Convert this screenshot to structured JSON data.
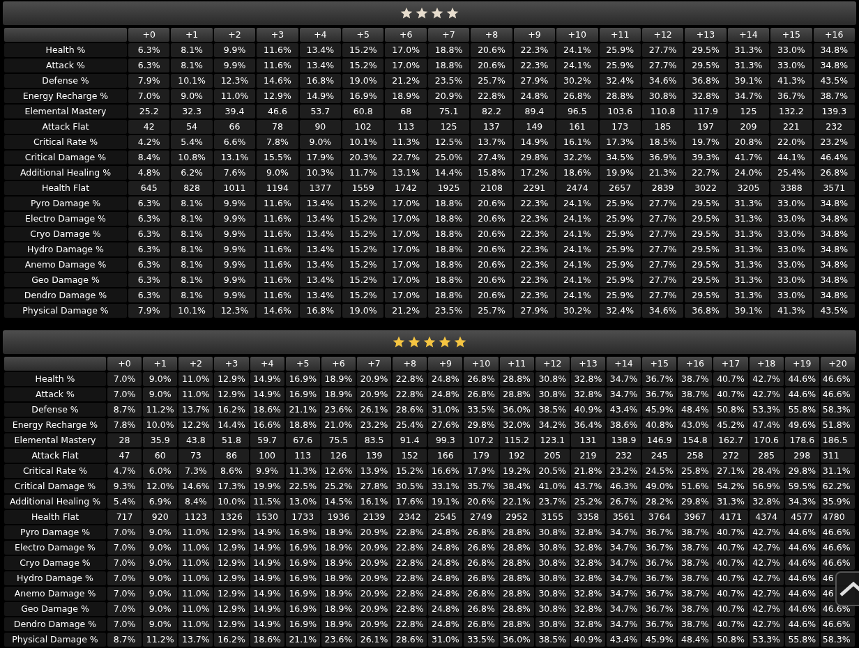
{
  "panels": [
    {
      "stars": 4,
      "color": "#e6dccd",
      "columns": [
        "+0",
        "+1",
        "+2",
        "+3",
        "+4",
        "+5",
        "+6",
        "+7",
        "+8",
        "+9",
        "+10",
        "+11",
        "+12",
        "+13",
        "+14",
        "+15",
        "+16"
      ],
      "rows": [
        {
          "label": "Health %",
          "cells": [
            "6.3%",
            "8.1%",
            "9.9%",
            "11.6%",
            "13.4%",
            "15.2%",
            "17.0%",
            "18.8%",
            "20.6%",
            "22.3%",
            "24.1%",
            "25.9%",
            "27.7%",
            "29.5%",
            "31.3%",
            "33.0%",
            "34.8%"
          ]
        },
        {
          "label": "Attack %",
          "cells": [
            "6.3%",
            "8.1%",
            "9.9%",
            "11.6%",
            "13.4%",
            "15.2%",
            "17.0%",
            "18.8%",
            "20.6%",
            "22.3%",
            "24.1%",
            "25.9%",
            "27.7%",
            "29.5%",
            "31.3%",
            "33.0%",
            "34.8%"
          ]
        },
        {
          "label": "Defense %",
          "cells": [
            "7.9%",
            "10.1%",
            "12.3%",
            "14.6%",
            "16.8%",
            "19.0%",
            "21.2%",
            "23.5%",
            "25.7%",
            "27.9%",
            "30.2%",
            "32.4%",
            "34.6%",
            "36.8%",
            "39.1%",
            "41.3%",
            "43.5%"
          ]
        },
        {
          "label": "Energy Recharge %",
          "cells": [
            "7.0%",
            "9.0%",
            "11.0%",
            "12.9%",
            "14.9%",
            "16.9%",
            "18.9%",
            "20.9%",
            "22.8%",
            "24.8%",
            "26.8%",
            "28.8%",
            "30.8%",
            "32.8%",
            "34.7%",
            "36.7%",
            "38.7%"
          ]
        },
        {
          "label": "Elemental Mastery",
          "cells": [
            "25.2",
            "32.3",
            "39.4",
            "46.6",
            "53.7",
            "60.8",
            "68",
            "75.1",
            "82.2",
            "89.4",
            "96.5",
            "103.6",
            "110.8",
            "117.9",
            "125",
            "132.2",
            "139.3"
          ]
        },
        {
          "label": "Attack Flat",
          "cells": [
            "42",
            "54",
            "66",
            "78",
            "90",
            "102",
            "113",
            "125",
            "137",
            "149",
            "161",
            "173",
            "185",
            "197",
            "209",
            "221",
            "232"
          ]
        },
        {
          "label": "Critical Rate %",
          "cells": [
            "4.2%",
            "5.4%",
            "6.6%",
            "7.8%",
            "9.0%",
            "10.1%",
            "11.3%",
            "12.5%",
            "13.7%",
            "14.9%",
            "16.1%",
            "17.3%",
            "18.5%",
            "19.7%",
            "20.8%",
            "22.0%",
            "23.2%"
          ]
        },
        {
          "label": "Critical Damage %",
          "cells": [
            "8.4%",
            "10.8%",
            "13.1%",
            "15.5%",
            "17.9%",
            "20.3%",
            "22.7%",
            "25.0%",
            "27.4%",
            "29.8%",
            "32.2%",
            "34.5%",
            "36.9%",
            "39.3%",
            "41.7%",
            "44.1%",
            "46.4%"
          ]
        },
        {
          "label": "Additional Healing %",
          "cells": [
            "4.8%",
            "6.2%",
            "7.6%",
            "9.0%",
            "10.3%",
            "11.7%",
            "13.1%",
            "14.4%",
            "15.8%",
            "17.2%",
            "18.6%",
            "19.9%",
            "21.3%",
            "22.7%",
            "24.0%",
            "25.4%",
            "26.8%"
          ]
        },
        {
          "label": "Health Flat",
          "cells": [
            "645",
            "828",
            "1011",
            "1194",
            "1377",
            "1559",
            "1742",
            "1925",
            "2108",
            "2291",
            "2474",
            "2657",
            "2839",
            "3022",
            "3205",
            "3388",
            "3571"
          ]
        },
        {
          "label": "Pyro Damage %",
          "cells": [
            "6.3%",
            "8.1%",
            "9.9%",
            "11.6%",
            "13.4%",
            "15.2%",
            "17.0%",
            "18.8%",
            "20.6%",
            "22.3%",
            "24.1%",
            "25.9%",
            "27.7%",
            "29.5%",
            "31.3%",
            "33.0%",
            "34.8%"
          ]
        },
        {
          "label": "Electro Damage %",
          "cells": [
            "6.3%",
            "8.1%",
            "9.9%",
            "11.6%",
            "13.4%",
            "15.2%",
            "17.0%",
            "18.8%",
            "20.6%",
            "22.3%",
            "24.1%",
            "25.9%",
            "27.7%",
            "29.5%",
            "31.3%",
            "33.0%",
            "34.8%"
          ]
        },
        {
          "label": "Cryo Damage %",
          "cells": [
            "6.3%",
            "8.1%",
            "9.9%",
            "11.6%",
            "13.4%",
            "15.2%",
            "17.0%",
            "18.8%",
            "20.6%",
            "22.3%",
            "24.1%",
            "25.9%",
            "27.7%",
            "29.5%",
            "31.3%",
            "33.0%",
            "34.8%"
          ]
        },
        {
          "label": "Hydro Damage %",
          "cells": [
            "6.3%",
            "8.1%",
            "9.9%",
            "11.6%",
            "13.4%",
            "15.2%",
            "17.0%",
            "18.8%",
            "20.6%",
            "22.3%",
            "24.1%",
            "25.9%",
            "27.7%",
            "29.5%",
            "31.3%",
            "33.0%",
            "34.8%"
          ]
        },
        {
          "label": "Anemo Damage %",
          "cells": [
            "6.3%",
            "8.1%",
            "9.9%",
            "11.6%",
            "13.4%",
            "15.2%",
            "17.0%",
            "18.8%",
            "20.6%",
            "22.3%",
            "24.1%",
            "25.9%",
            "27.7%",
            "29.5%",
            "31.3%",
            "33.0%",
            "34.8%"
          ]
        },
        {
          "label": "Geo Damage %",
          "cells": [
            "6.3%",
            "8.1%",
            "9.9%",
            "11.6%",
            "13.4%",
            "15.2%",
            "17.0%",
            "18.8%",
            "20.6%",
            "22.3%",
            "24.1%",
            "25.9%",
            "27.7%",
            "29.5%",
            "31.3%",
            "33.0%",
            "34.8%"
          ]
        },
        {
          "label": "Dendro Damage %",
          "cells": [
            "6.3%",
            "8.1%",
            "9.9%",
            "11.6%",
            "13.4%",
            "15.2%",
            "17.0%",
            "18.8%",
            "20.6%",
            "22.3%",
            "24.1%",
            "25.9%",
            "27.7%",
            "29.5%",
            "31.3%",
            "33.0%",
            "34.8%"
          ]
        },
        {
          "label": "Physical Damage %",
          "cells": [
            "7.9%",
            "10.1%",
            "12.3%",
            "14.6%",
            "16.8%",
            "19.0%",
            "21.2%",
            "23.5%",
            "25.7%",
            "27.9%",
            "30.2%",
            "32.4%",
            "34.6%",
            "36.8%",
            "39.1%",
            "41.3%",
            "43.5%"
          ]
        }
      ]
    },
    {
      "stars": 5,
      "color": "#f5c542",
      "columns": [
        "+0",
        "+1",
        "+2",
        "+3",
        "+4",
        "+5",
        "+6",
        "+7",
        "+8",
        "+9",
        "+10",
        "+11",
        "+12",
        "+13",
        "+14",
        "+15",
        "+16",
        "+17",
        "+18",
        "+19",
        "+20"
      ],
      "rows": [
        {
          "label": "Health %",
          "cells": [
            "7.0%",
            "9.0%",
            "11.0%",
            "12.9%",
            "14.9%",
            "16.9%",
            "18.9%",
            "20.9%",
            "22.8%",
            "24.8%",
            "26.8%",
            "28.8%",
            "30.8%",
            "32.8%",
            "34.7%",
            "36.7%",
            "38.7%",
            "40.7%",
            "42.7%",
            "44.6%",
            "46.6%"
          ]
        },
        {
          "label": "Attack %",
          "cells": [
            "7.0%",
            "9.0%",
            "11.0%",
            "12.9%",
            "14.9%",
            "16.9%",
            "18.9%",
            "20.9%",
            "22.8%",
            "24.8%",
            "26.8%",
            "28.8%",
            "30.8%",
            "32.8%",
            "34.7%",
            "36.7%",
            "38.7%",
            "40.7%",
            "42.7%",
            "44.6%",
            "46.6%"
          ]
        },
        {
          "label": "Defense %",
          "cells": [
            "8.7%",
            "11.2%",
            "13.7%",
            "16.2%",
            "18.6%",
            "21.1%",
            "23.6%",
            "26.1%",
            "28.6%",
            "31.0%",
            "33.5%",
            "36.0%",
            "38.5%",
            "40.9%",
            "43.4%",
            "45.9%",
            "48.4%",
            "50.8%",
            "53.3%",
            "55.8%",
            "58.3%"
          ]
        },
        {
          "label": "Energy Recharge %",
          "cells": [
            "7.8%",
            "10.0%",
            "12.2%",
            "14.4%",
            "16.6%",
            "18.8%",
            "21.0%",
            "23.2%",
            "25.4%",
            "27.6%",
            "29.8%",
            "32.0%",
            "34.2%",
            "36.4%",
            "38.6%",
            "40.8%",
            "43.0%",
            "45.2%",
            "47.4%",
            "49.6%",
            "51.8%"
          ]
        },
        {
          "label": "Elemental Mastery",
          "cells": [
            "28",
            "35.9",
            "43.8",
            "51.8",
            "59.7",
            "67.6",
            "75.5",
            "83.5",
            "91.4",
            "99.3",
            "107.2",
            "115.2",
            "123.1",
            "131",
            "138.9",
            "146.9",
            "154.8",
            "162.7",
            "170.6",
            "178.6",
            "186.5"
          ]
        },
        {
          "label": "Attack Flat",
          "cells": [
            "47",
            "60",
            "73",
            "86",
            "100",
            "113",
            "126",
            "139",
            "152",
            "166",
            "179",
            "192",
            "205",
            "219",
            "232",
            "245",
            "258",
            "272",
            "285",
            "298",
            "311"
          ]
        },
        {
          "label": "Critical Rate %",
          "cells": [
            "4.7%",
            "6.0%",
            "7.3%",
            "8.6%",
            "9.9%",
            "11.3%",
            "12.6%",
            "13.9%",
            "15.2%",
            "16.6%",
            "17.9%",
            "19.2%",
            "20.5%",
            "21.8%",
            "23.2%",
            "24.5%",
            "25.8%",
            "27.1%",
            "28.4%",
            "29.8%",
            "31.1%"
          ]
        },
        {
          "label": "Critical Damage %",
          "cells": [
            "9.3%",
            "12.0%",
            "14.6%",
            "17.3%",
            "19.9%",
            "22.5%",
            "25.2%",
            "27.8%",
            "30.5%",
            "33.1%",
            "35.7%",
            "38.4%",
            "41.0%",
            "43.7%",
            "46.3%",
            "49.0%",
            "51.6%",
            "54.2%",
            "56.9%",
            "59.5%",
            "62.2%"
          ]
        },
        {
          "label": "Additional Healing %",
          "cells": [
            "5.4%",
            "6.9%",
            "8.4%",
            "10.0%",
            "11.5%",
            "13.0%",
            "14.5%",
            "16.1%",
            "17.6%",
            "19.1%",
            "20.6%",
            "22.1%",
            "23.7%",
            "25.2%",
            "26.7%",
            "28.2%",
            "29.8%",
            "31.3%",
            "32.8%",
            "34.3%",
            "35.9%"
          ]
        },
        {
          "label": "Health Flat",
          "cells": [
            "717",
            "920",
            "1123",
            "1326",
            "1530",
            "1733",
            "1936",
            "2139",
            "2342",
            "2545",
            "2749",
            "2952",
            "3155",
            "3358",
            "3561",
            "3764",
            "3967",
            "4171",
            "4374",
            "4577",
            "4780"
          ]
        },
        {
          "label": "Pyro Damage %",
          "cells": [
            "7.0%",
            "9.0%",
            "11.0%",
            "12.9%",
            "14.9%",
            "16.9%",
            "18.9%",
            "20.9%",
            "22.8%",
            "24.8%",
            "26.8%",
            "28.8%",
            "30.8%",
            "32.8%",
            "34.7%",
            "36.7%",
            "38.7%",
            "40.7%",
            "42.7%",
            "44.6%",
            "46.6%"
          ]
        },
        {
          "label": "Electro Damage %",
          "cells": [
            "7.0%",
            "9.0%",
            "11.0%",
            "12.9%",
            "14.9%",
            "16.9%",
            "18.9%",
            "20.9%",
            "22.8%",
            "24.8%",
            "26.8%",
            "28.8%",
            "30.8%",
            "32.8%",
            "34.7%",
            "36.7%",
            "38.7%",
            "40.7%",
            "42.7%",
            "44.6%",
            "46.6%"
          ]
        },
        {
          "label": "Cryo Damage %",
          "cells": [
            "7.0%",
            "9.0%",
            "11.0%",
            "12.9%",
            "14.9%",
            "16.9%",
            "18.9%",
            "20.9%",
            "22.8%",
            "24.8%",
            "26.8%",
            "28.8%",
            "30.8%",
            "32.8%",
            "34.7%",
            "36.7%",
            "38.7%",
            "40.7%",
            "42.7%",
            "44.6%",
            "46.6%"
          ]
        },
        {
          "label": "Hydro Damage %",
          "cells": [
            "7.0%",
            "9.0%",
            "11.0%",
            "12.9%",
            "14.9%",
            "16.9%",
            "18.9%",
            "20.9%",
            "22.8%",
            "24.8%",
            "26.8%",
            "28.8%",
            "30.8%",
            "32.8%",
            "34.7%",
            "36.7%",
            "38.7%",
            "40.7%",
            "42.7%",
            "44.6%",
            "46"
          ]
        },
        {
          "label": "Anemo Damage %",
          "cells": [
            "7.0%",
            "9.0%",
            "11.0%",
            "12.9%",
            "14.9%",
            "16.9%",
            "18.9%",
            "20.9%",
            "22.8%",
            "24.8%",
            "26.8%",
            "28.8%",
            "30.8%",
            "32.8%",
            "34.7%",
            "36.7%",
            "38.7%",
            "40.7%",
            "42.7%",
            "44.6%",
            "46"
          ]
        },
        {
          "label": "Geo Damage %",
          "cells": [
            "7.0%",
            "9.0%",
            "11.0%",
            "12.9%",
            "14.9%",
            "16.9%",
            "18.9%",
            "20.9%",
            "22.8%",
            "24.8%",
            "26.8%",
            "28.8%",
            "30.8%",
            "32.8%",
            "34.7%",
            "36.7%",
            "38.7%",
            "40.7%",
            "42.7%",
            "44.6%",
            "46.6%"
          ]
        },
        {
          "label": "Dendro Damage %",
          "cells": [
            "7.0%",
            "9.0%",
            "11.0%",
            "12.9%",
            "14.9%",
            "16.9%",
            "18.9%",
            "20.9%",
            "22.8%",
            "24.8%",
            "26.8%",
            "28.8%",
            "30.8%",
            "32.8%",
            "34.7%",
            "36.7%",
            "38.7%",
            "40.7%",
            "42.7%",
            "44.6%",
            "46.6%"
          ]
        },
        {
          "label": "Physical Damage %",
          "cells": [
            "8.7%",
            "11.2%",
            "13.7%",
            "16.2%",
            "18.6%",
            "21.1%",
            "23.6%",
            "26.1%",
            "28.6%",
            "31.0%",
            "33.5%",
            "36.0%",
            "38.5%",
            "40.9%",
            "43.4%",
            "45.9%",
            "48.4%",
            "50.8%",
            "53.3%",
            "55.8%",
            "58.3%"
          ]
        }
      ]
    }
  ]
}
